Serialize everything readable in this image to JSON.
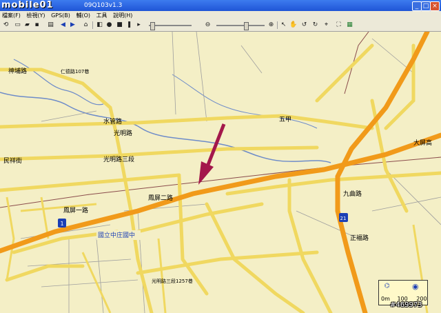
{
  "window": {
    "logo": "mobile01",
    "title": "09Q103v1.3",
    "minimize": "_",
    "maximize": "□",
    "close": "×"
  },
  "menu": {
    "items": [
      "檔案(F)",
      "檢視(Y)",
      "GPS(B)",
      "輔(O)",
      "工具",
      "說明(H)"
    ]
  },
  "map_labels": {
    "shenpu_road": "神埔路",
    "renai_alley": "仁德路107巷",
    "renai_road": "仁德路",
    "shuiguan_road": "水管路",
    "guangming_road": "光明路",
    "guangming_3": "光明路三段",
    "minzhi_street": "民祥街",
    "fengping_1": "鳳屏一路",
    "fengping_2": "鳳屏二路",
    "school": "國立中庄國中",
    "xiangshun": "光明路三段1257巷",
    "wuxiang": "五甲",
    "dakeng": "大屏高",
    "jiuqu_road": "九曲路",
    "zhengfu_road": "正福路",
    "highway_1": "1",
    "highway_21": "21",
    "watermark": "#469973"
  },
  "scale": {
    "left": "0m",
    "mid": "100",
    "right": "200"
  }
}
